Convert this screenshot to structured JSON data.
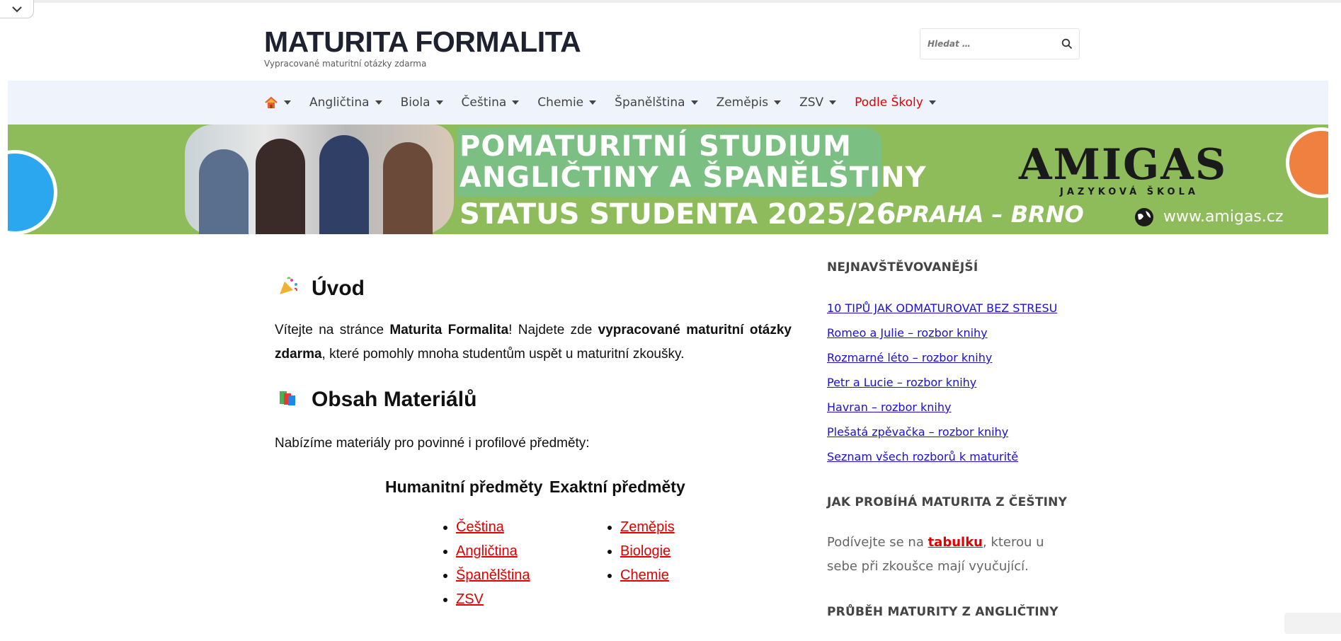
{
  "header": {
    "site_title": "MATURITA FORMALITA",
    "tagline": "Vypracované maturitní otázky zdarma",
    "search_placeholder": "Hledat …"
  },
  "nav": {
    "home_icon": "home-icon",
    "items": [
      {
        "label": "Angličtina"
      },
      {
        "label": "Biola"
      },
      {
        "label": "Čeština"
      },
      {
        "label": "Chemie"
      },
      {
        "label": "Španělština"
      },
      {
        "label": "Zeměpis"
      },
      {
        "label": "ZSV"
      },
      {
        "label": "Podle Školy"
      }
    ],
    "accent_color": "#e00000"
  },
  "banner": {
    "line1": "POMATURITNÍ STUDIUM",
    "line2": "ANGLIČTINY A ŠPANĚLŠTINY",
    "line3": "STATUS STUDENTA 2025/26",
    "city": "PRAHA – BRNO",
    "brand": "AMIGAS",
    "brand_sub": "JAZYKOVÁ ŠKOLA",
    "url": "www.amigas.cz"
  },
  "main": {
    "intro_heading": "Úvod",
    "intro_p1": "Vítejte na stránce ",
    "intro_bold1": "Maturita Formalita",
    "intro_p2": "! Najdete zde ",
    "intro_bold2": "vypracované maturitní otázky zdarma",
    "intro_p3": ", které pomohly mnoha studentům uspět u maturitní zkoušky.",
    "materials_heading": "Obsah Materiálů",
    "materials_text": "Nabízíme materiály pro povinné i profilové předměty:",
    "col1_head": "Humanitní předměty",
    "col2_head": "Exaktní předměty",
    "col1_items": [
      "Čeština",
      "Angličtina",
      "Španělština",
      "ZSV"
    ],
    "col2_items": [
      "Zeměpis",
      "Biologie",
      "Chemie"
    ]
  },
  "sidebar": {
    "heading1": "NEJNAVŠTĚVOVANĚJŠÍ",
    "links": [
      "10 TIPŮ JAK ODMATUROVAT BEZ STRESU",
      "Romeo a Julie – rozbor knihy",
      "Rozmarné léto – rozbor knihy",
      "Petr a Lucie – rozbor knihy",
      "Havran – rozbor knihy",
      "Plešatá zpěvačka – rozbor knihy",
      "Seznam všech rozborů k maturitě"
    ],
    "heading2": "JAK PROBÍHÁ MATURITA Z ČEŠTINY",
    "text_pre": "Podívejte se na ",
    "text_link": "tabulku",
    "text_post": ", kterou u sebe při zkoušce mají vyučující.",
    "heading3": "PRŮBĚH MATURITY Z ANGLIČTINY"
  }
}
